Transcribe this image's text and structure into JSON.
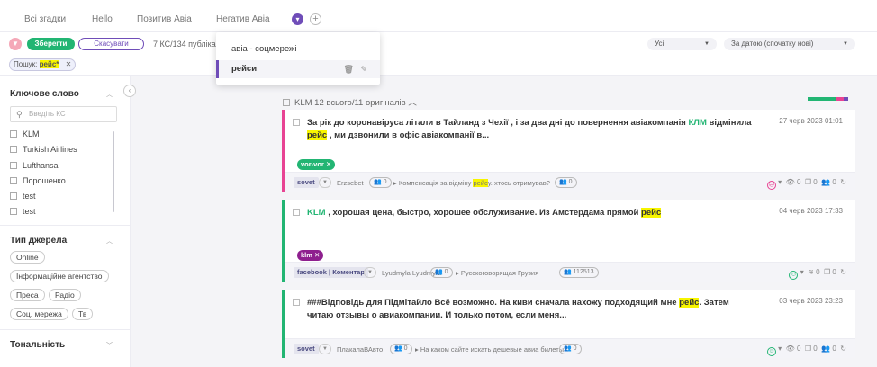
{
  "tabs": [
    "Всі згадки",
    "Hello",
    "Позитив Авіа",
    "Негатив Авіа"
  ],
  "toolbar": {
    "save_label": "Зберегти",
    "cancel_label": "Скасувати",
    "kc_count": "7 КС/134 публіка",
    "search_chip_prefix": "Пошук:",
    "search_chip_term": "рейс*",
    "select_all": "Усі",
    "select_sort": "За датою (спочатку нові)"
  },
  "dropdown": {
    "items": [
      "авіа - соцмережі",
      "рейси"
    ]
  },
  "sidebar": {
    "keyword_title": "Ключове слово",
    "keyword_placeholder": "Введіть КС",
    "keywords": [
      "KLM",
      "Turkish Airlines",
      "Lufthansa",
      "Порошенко",
      "test",
      "test"
    ],
    "source_title": "Тип джерела",
    "sources": [
      "Online",
      "Інформаційне агентство",
      "Преса",
      "Радіо",
      "Соц. мережа",
      "Тв"
    ],
    "tone_title": "Тональність"
  },
  "main": {
    "group_label": "KLM 12 всього/11 оригіналів",
    "tone_segments": [
      {
        "color": "#22b573",
        "fraction": 0.6
      },
      {
        "color": "#e84393",
        "fraction": 0.25
      },
      {
        "color": "#6f4db8",
        "fraction": 0.15
      }
    ],
    "cards": [
      {
        "tone": "negative",
        "text_a": "За рік до коронавіруса літали в Тайланд з Чехії , і за два дні до повернення авіакомпанія ",
        "kw": "КЛМ",
        "text_b": " відмінила ",
        "hl": "рейс",
        "text_c": " , ми дзвонили в офіс авіакомпанії в...",
        "date": "27 черв 2023 01:01",
        "tag": "vor-vor",
        "tag_color": "#22b573",
        "source": "sovet",
        "author": "Erzsebet",
        "author_count": "0",
        "thread_a": "Компенсація за відміну ",
        "thread_hl": "рейс",
        "thread_b": "у. хтось отримував?",
        "thread_count": "0",
        "stats": "0  0  0"
      },
      {
        "tone": "positive",
        "text_a": "",
        "kw": "KLM",
        "text_b": " , хорошая цена, быстро, хорошее обслуживание. Из Амстердама прямой ",
        "hl": "рейс",
        "text_c": "",
        "date": "04 черв 2023 17:33",
        "tag": "klm",
        "tag_color": "#8e1f8e",
        "source": "facebook | Коментар",
        "author": "Lyudmyla Lyudmyla",
        "author_count": "0",
        "thread_a": "Русскоговорящая Грузия",
        "thread_hl": "",
        "thread_b": "",
        "thread_count": "112513",
        "stats": "0  0  0"
      },
      {
        "tone": "positive",
        "text_a": "###Відповідь для Підмітайло Всё возможно. На киви сначала нахожу подходящий мне ",
        "kw": "",
        "text_b": "",
        "hl": "рейс",
        "text_c": ". Затем читаю отзывы о авиакомпании. И только потом, если меня...",
        "date": "03 черв 2023 23:23",
        "tag": "",
        "tag_color": "",
        "source": "sovet",
        "author": "ПлакалаВАвто",
        "author_count": "0",
        "thread_a": "На каком сайте искать дешевые авиа билеты",
        "thread_hl": "",
        "thread_b": "",
        "thread_count": "0",
        "stats": "0  0  0"
      }
    ]
  },
  "colors": {
    "accent": "#6f4db8",
    "positive": "#22b573",
    "negative": "#e84393",
    "highlight": "#f7f500"
  }
}
